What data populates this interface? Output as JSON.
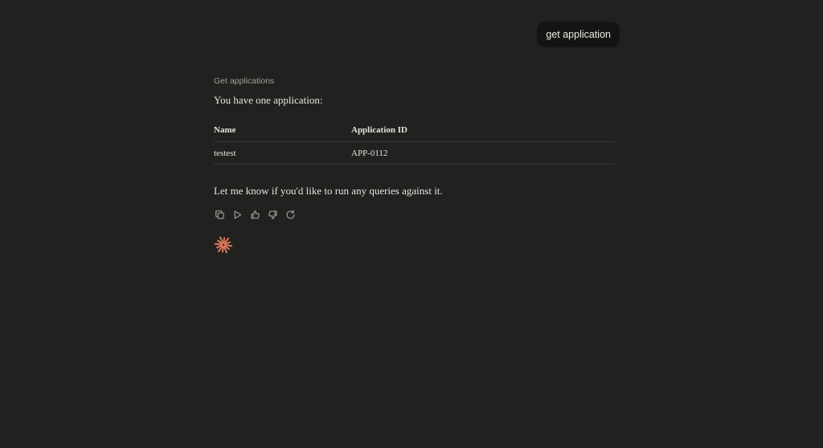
{
  "user_message": {
    "text": "get application"
  },
  "assistant_message": {
    "tool_label": "Get applications",
    "intro": "You have one application:",
    "table": {
      "headers": [
        "Name",
        "Application ID"
      ],
      "rows": [
        [
          "testest",
          "APP-0112"
        ]
      ]
    },
    "outro": "Let me know if you'd like to run any queries against it.",
    "actions": [
      {
        "name": "copy",
        "icon": "copy-icon"
      },
      {
        "name": "play",
        "icon": "play-icon"
      },
      {
        "name": "thumbs-up",
        "icon": "thumbs-up-icon"
      },
      {
        "name": "thumbs-down",
        "icon": "thumbs-down-icon"
      },
      {
        "name": "retry",
        "icon": "retry-icon"
      }
    ]
  },
  "colors": {
    "background": "#212120",
    "bubble": "#141413",
    "accent_spark": "#d97757",
    "icon": "#9c9a93"
  }
}
